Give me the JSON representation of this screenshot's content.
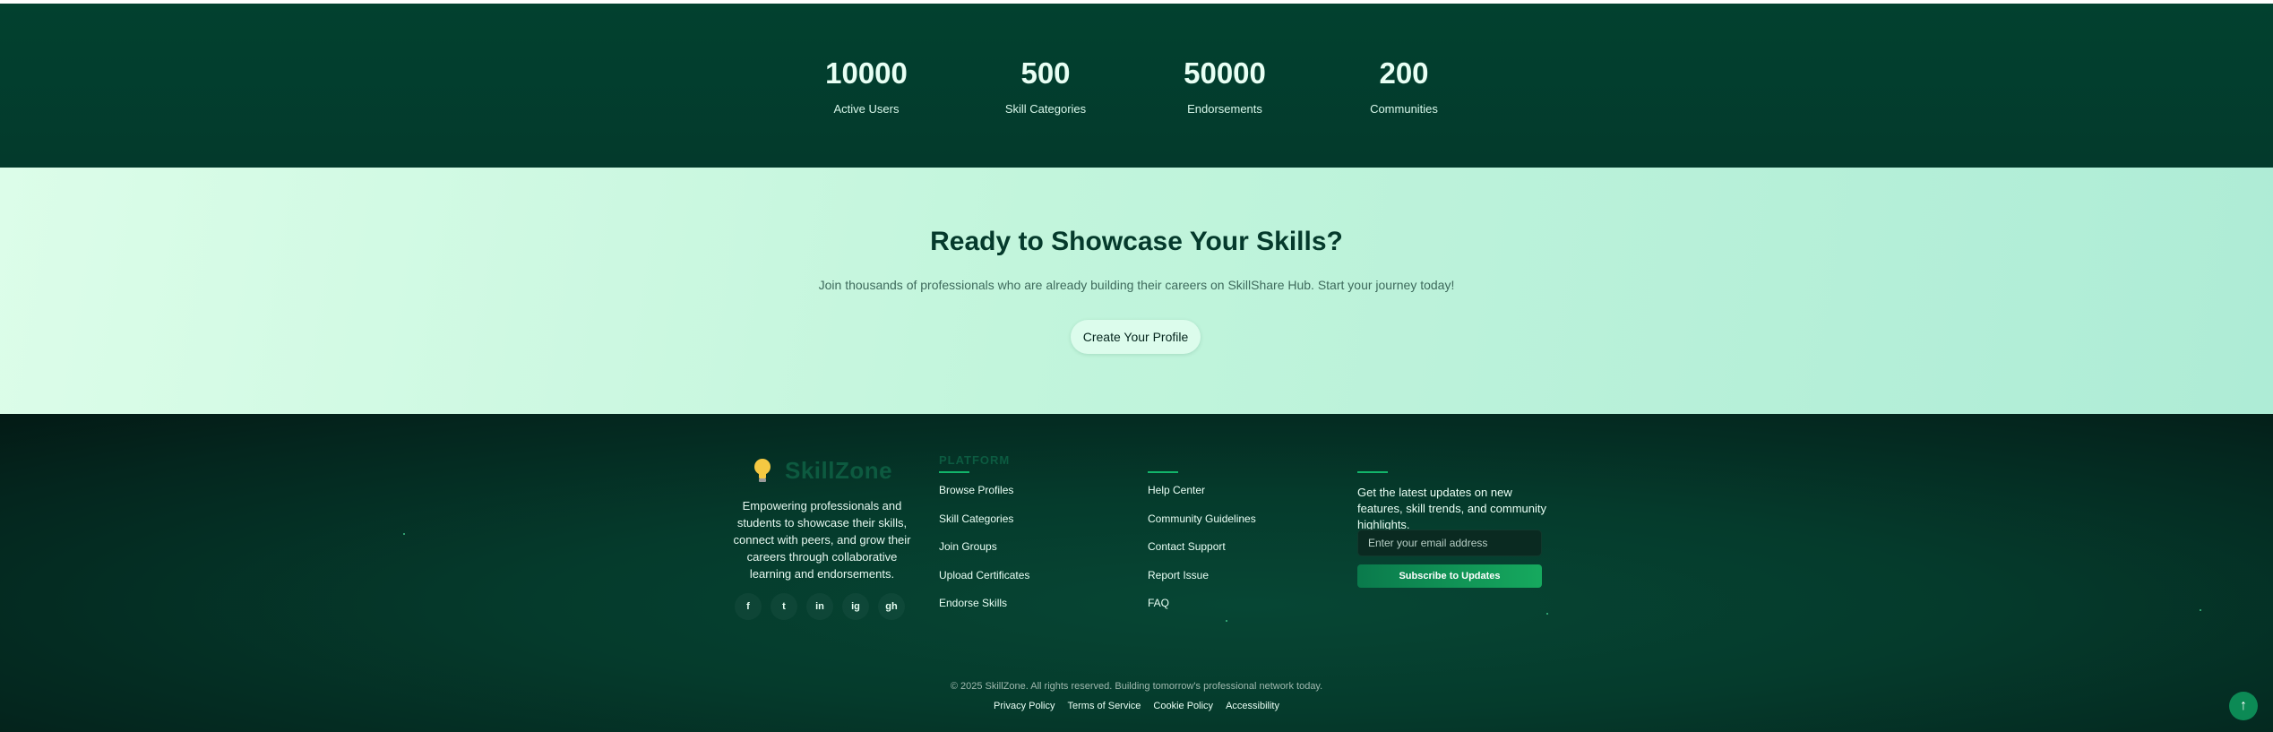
{
  "stats": [
    {
      "value": "10000",
      "label": "Active Users"
    },
    {
      "value": "500",
      "label": "Skill Categories"
    },
    {
      "value": "50000",
      "label": "Endorsements"
    },
    {
      "value": "200",
      "label": "Communities"
    }
  ],
  "cta": {
    "title": "Ready to Showcase Your Skills?",
    "subtitle": "Join thousands of professionals who are already building their careers on SkillShare Hub. Start your journey today!",
    "button": "Create Your Profile"
  },
  "footer": {
    "brand": {
      "icon": "lightbulb-icon",
      "name": "SkillZone"
    },
    "about": "Empowering professionals and students to showcase their skills, connect with peers, and grow their careers through collaborative learning and endorsements.",
    "socials": [
      "f",
      "t",
      "in",
      "ig",
      "gh"
    ],
    "platform": {
      "heading": "PLATFORM",
      "links": [
        "Browse Profiles",
        "Skill Categories",
        "Join Groups",
        "Upload Certificates",
        "Endorse Skills"
      ]
    },
    "support": {
      "links": [
        "Help Center",
        "Community Guidelines",
        "Contact Support",
        "Report Issue",
        "FAQ"
      ]
    },
    "newsletter": {
      "text": "Get the latest updates on new features, skill trends, and community highlights.",
      "placeholder": "Enter your email address",
      "button": "Subscribe to Updates"
    },
    "copyright": "© 2025 SkillZone. All rights reserved. Building tomorrow's professional network today.",
    "legal": [
      "Privacy Policy",
      "Terms of Service",
      "Cookie Policy",
      "Accessibility"
    ]
  },
  "back_to_top": "↑",
  "colors": {
    "accent": "#12b56a",
    "dark": "#053a2c",
    "cta_bg": "#c2f5dc"
  }
}
